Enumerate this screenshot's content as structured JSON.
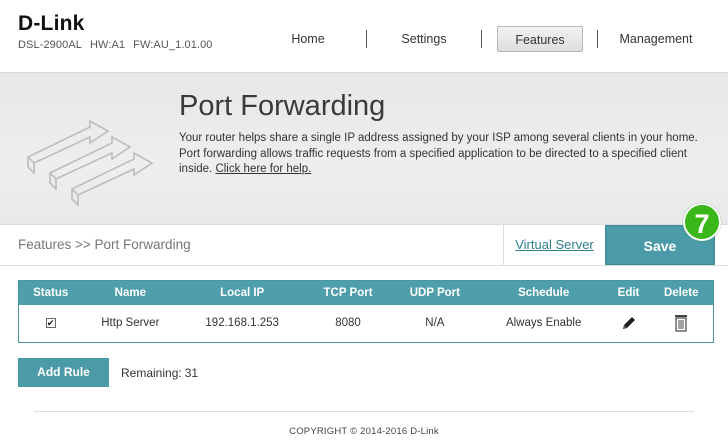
{
  "header": {
    "logo": "D-Link",
    "model": "DSL-2900AL",
    "hw": "HW:A1",
    "fw": "FW:AU_1.01.00",
    "nav": [
      {
        "label": "Home"
      },
      {
        "label": "Settings"
      },
      {
        "label": "Features",
        "active": true
      },
      {
        "label": "Management"
      }
    ]
  },
  "banner": {
    "title": "Port Forwarding",
    "description": "Your router helps share a single IP address assigned by your ISP among several clients in your home. Port forwarding allows traffic requests from a specified application to be directed to a specified client inside. ",
    "help_link": "Click here for help."
  },
  "bar": {
    "breadcrumb": "Features >> Port Forwarding",
    "virtual_server": "Virtual Server",
    "save": "Save",
    "step": "7"
  },
  "table": {
    "headers": [
      "Status",
      "Name",
      "Local IP",
      "TCP Port",
      "UDP Port",
      "Schedule",
      "Edit",
      "Delete"
    ],
    "rows": [
      {
        "status": "checked",
        "name": "Http Server",
        "local_ip": "192.168.1.253",
        "tcp_port": "8080",
        "udp_port": "N/A",
        "schedule": "Always Enable"
      }
    ]
  },
  "add_rule": {
    "label": "Add Rule",
    "remaining_label": "Remaining:",
    "remaining_value": "31"
  },
  "footer": {
    "copyright": "COPYRIGHT © 2014-2016 D-Link"
  },
  "colors": {
    "accent": "#4a9aa8",
    "badge": "#3ab81a"
  },
  "icons": {
    "edit": "pencil-icon",
    "delete": "trash-icon",
    "banner": "port-arrows-icon"
  }
}
